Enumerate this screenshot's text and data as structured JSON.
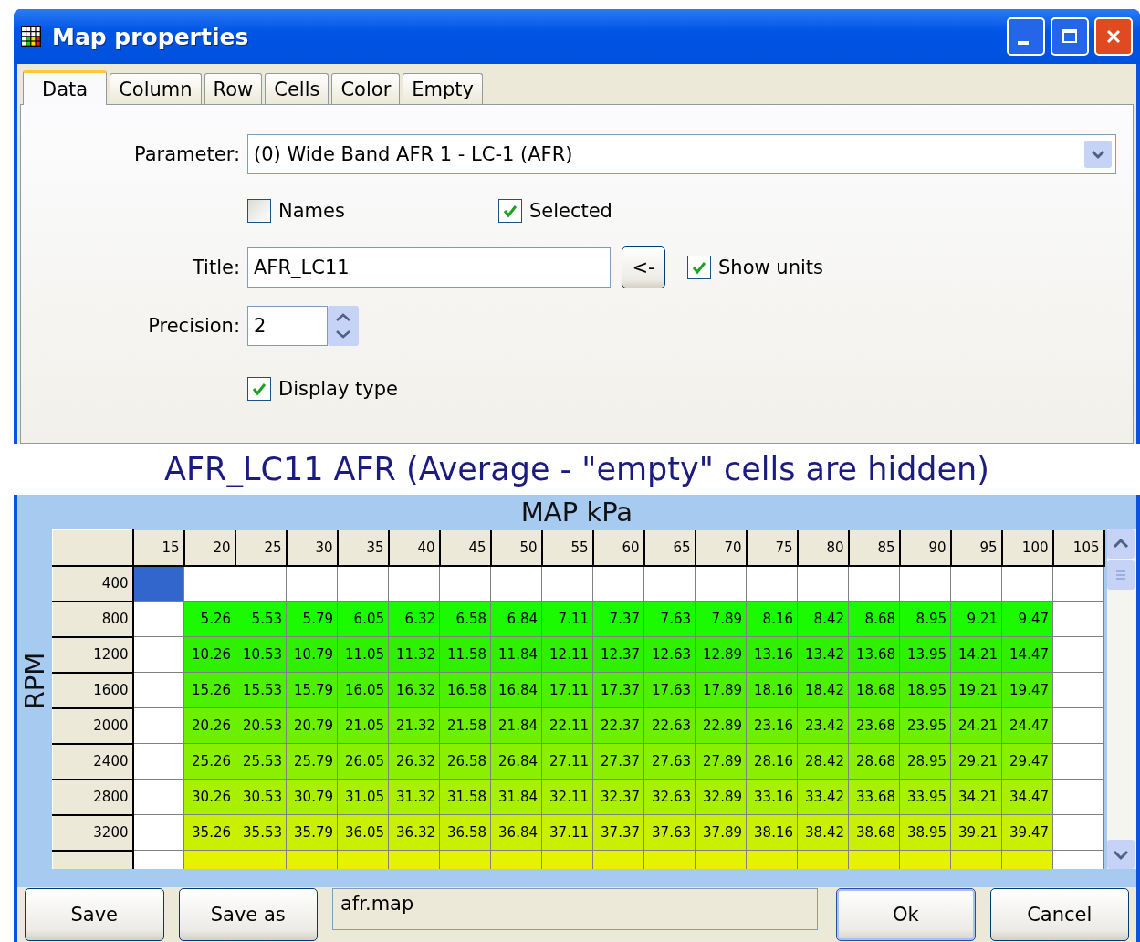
{
  "window": {
    "title": "Map properties"
  },
  "tabs": [
    {
      "label": "Data",
      "selected": true
    },
    {
      "label": "Column",
      "selected": false
    },
    {
      "label": "Row",
      "selected": false
    },
    {
      "label": "Cells",
      "selected": false
    },
    {
      "label": "Color",
      "selected": false
    },
    {
      "label": "Empty",
      "selected": false
    }
  ],
  "form": {
    "parameter_label": "Parameter:",
    "parameter_value": "(0) Wide Band AFR 1 - LC-1 (AFR)",
    "names": {
      "label": "Names",
      "checked": false
    },
    "selected": {
      "label": "Selected",
      "checked": true
    },
    "title_label": "Title:",
    "title_value": "AFR_LC11",
    "arrow_button": "<-",
    "show_units": {
      "label": "Show units",
      "checked": true
    },
    "precision_label": "Precision:",
    "precision_value": "2",
    "display_type": {
      "label": "Display type",
      "checked": true
    }
  },
  "map": {
    "heading": "AFR_LC11 AFR (Average - \"empty\" cells are hidden)",
    "x_axis": "MAP kPa",
    "y_axis": "RPM",
    "columns": [
      "15",
      "20",
      "25",
      "30",
      "35",
      "40",
      "45",
      "50",
      "55",
      "60",
      "65",
      "70",
      "75",
      "80",
      "85",
      "90",
      "95",
      "100",
      "105"
    ],
    "rows": [
      {
        "label": "400",
        "cells": [
          {
            "selected": true
          },
          {
            "selected": false
          },
          {
            "selected": false
          },
          {
            "selected": false
          },
          {
            "selected": false
          },
          {
            "selected": false
          },
          {
            "selected": false
          },
          {
            "selected": false
          },
          {
            "selected": false
          },
          {
            "selected": false
          },
          {
            "selected": false
          },
          {
            "selected": false
          },
          {
            "selected": false
          },
          {
            "selected": false
          },
          {
            "selected": false
          },
          {
            "selected": false
          },
          {
            "selected": false
          },
          {
            "selected": false
          },
          {
            "selected": false
          }
        ]
      },
      {
        "label": "800",
        "color": "#1cfa00",
        "cells": [
          null,
          "5.26",
          "5.53",
          "5.79",
          "6.05",
          "6.32",
          "6.58",
          "6.84",
          "7.11",
          "7.37",
          "7.63",
          "7.89",
          "8.16",
          "8.42",
          "8.68",
          "8.95",
          "9.21",
          "9.47",
          null
        ]
      },
      {
        "label": "1200",
        "color": "#2ef000",
        "cells": [
          null,
          "10.26",
          "10.53",
          "10.79",
          "11.05",
          "11.32",
          "11.58",
          "11.84",
          "12.11",
          "12.37",
          "12.63",
          "12.89",
          "13.16",
          "13.42",
          "13.68",
          "13.95",
          "14.21",
          "14.47",
          null
        ]
      },
      {
        "label": "1600",
        "color": "#4cf000",
        "cells": [
          null,
          "15.26",
          "15.53",
          "15.79",
          "16.05",
          "16.32",
          "16.58",
          "16.84",
          "17.11",
          "17.37",
          "17.63",
          "17.89",
          "18.16",
          "18.42",
          "18.68",
          "18.95",
          "19.21",
          "19.47",
          null
        ]
      },
      {
        "label": "2000",
        "color": "#6af000",
        "cells": [
          null,
          "20.26",
          "20.53",
          "20.79",
          "21.05",
          "21.32",
          "21.58",
          "21.84",
          "22.11",
          "22.37",
          "22.63",
          "22.89",
          "23.16",
          "23.42",
          "23.68",
          "23.95",
          "24.21",
          "24.47",
          null
        ]
      },
      {
        "label": "2400",
        "color": "#88f000",
        "cells": [
          null,
          "25.26",
          "25.53",
          "25.79",
          "26.05",
          "26.32",
          "26.58",
          "26.84",
          "27.11",
          "27.37",
          "27.63",
          "27.89",
          "28.16",
          "28.42",
          "28.68",
          "28.95",
          "29.21",
          "29.47",
          null
        ]
      },
      {
        "label": "2800",
        "color": "#a8f000",
        "cells": [
          null,
          "30.26",
          "30.53",
          "30.79",
          "31.05",
          "31.32",
          "31.58",
          "31.84",
          "32.11",
          "32.37",
          "32.63",
          "32.89",
          "33.16",
          "33.42",
          "33.68",
          "33.95",
          "34.21",
          "34.47",
          null
        ]
      },
      {
        "label": "3200",
        "color": "#c8f000",
        "cells": [
          null,
          "35.26",
          "35.53",
          "35.79",
          "36.05",
          "36.32",
          "36.58",
          "36.84",
          "37.11",
          "37.37",
          "37.63",
          "37.89",
          "38.16",
          "38.42",
          "38.68",
          "38.95",
          "39.21",
          "39.47",
          null
        ]
      },
      {
        "color": "#e4f400"
      }
    ]
  },
  "footer": {
    "save": "Save",
    "save_as": "Save as",
    "file": "afr.map",
    "ok": "Ok",
    "cancel": "Cancel"
  }
}
